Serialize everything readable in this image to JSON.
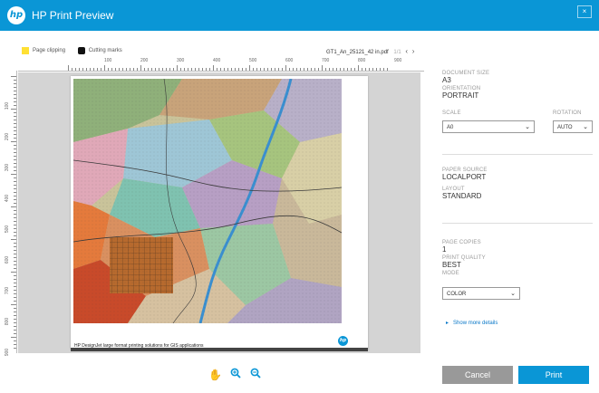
{
  "window": {
    "title": "HP Print Preview",
    "close_label": "×",
    "logo": "hp"
  },
  "toolbar": {
    "page_clipping": "Page clipping",
    "cutting_marks": "Cutting marks",
    "filename": "GT1_An_25121_42 in.pdf",
    "page_info": "1/1"
  },
  "ruler": {
    "top": [
      "100",
      "200",
      "300",
      "400",
      "500",
      "600",
      "700",
      "800",
      "900"
    ],
    "left": [
      "100",
      "200",
      "300",
      "400",
      "500",
      "600",
      "700",
      "800",
      "900"
    ]
  },
  "preview": {
    "caption": "HP DesignJet large format printing solutions for GIS applications",
    "hp_badge": "hp"
  },
  "panel": {
    "document_size_label": "DOCUMENT SIZE",
    "document_size": "A3",
    "orientation_label": "ORIENTATION",
    "orientation": "PORTRAIT",
    "scale_label": "SCALE",
    "scale_value": "A0",
    "rotation_label": "ROTATION",
    "rotation_value": "AUTO",
    "paper_source_label": "PAPER SOURCE",
    "paper_source": "LOCALPORT",
    "layout_label": "LAYOUT",
    "layout": "STANDARD",
    "page_copies_label": "PAGE COPIES",
    "page_copies": "1",
    "print_quality_label": "PRINT QUALITY",
    "print_quality": "BEST",
    "mode_label": "MODE",
    "mode_value": "COLOR",
    "show_more": "Show more details"
  },
  "buttons": {
    "cancel": "Cancel",
    "print": "Print"
  },
  "icons": [
    "hand-icon",
    "zoom-in-icon",
    "zoom-out-icon"
  ],
  "colors": {
    "accent": "#0a96d6"
  }
}
